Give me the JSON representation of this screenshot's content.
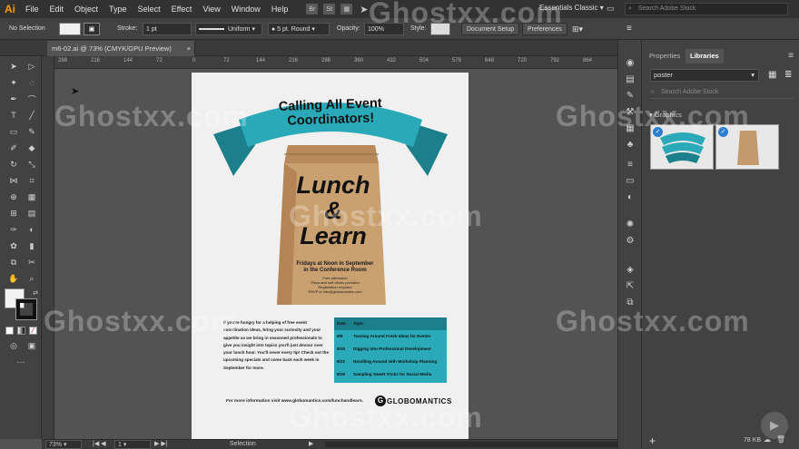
{
  "app": {
    "logo": "Ai",
    "menu": [
      "File",
      "Edit",
      "Object",
      "Type",
      "Select",
      "Effect",
      "View",
      "Window",
      "Help"
    ],
    "workspace": "Essentials Classic",
    "search_placeholder": "Search Adobe Stock",
    "bridge_icon": "Br",
    "stock_icon": "St"
  },
  "control": {
    "selection": "No Selection",
    "stroke_label": "Stroke:",
    "stroke_value": "1 pt",
    "profile": "Uniform",
    "brush": "5 pt. Round",
    "opacity_label": "Opacity:",
    "opacity_value": "100%",
    "style_label": "Style:",
    "doc_setup": "Document Setup",
    "preferences": "Preferences"
  },
  "document": {
    "tab_title": "m6-02.ai @ 73% (CMYK/GPU Preview)",
    "close": "×"
  },
  "ruler": {
    "ticks": [
      "288",
      "216",
      "144",
      "72",
      "0",
      "72",
      "144",
      "216",
      "288",
      "360",
      "432",
      "504",
      "576",
      "648",
      "720",
      "792",
      "864"
    ]
  },
  "poster": {
    "banner": "Calling All Event Coordinators!",
    "bag_line1": "Lunch",
    "bag_line2": "&",
    "bag_line3": "Learn",
    "bag_sub1": "Fridays at Noon in September",
    "bag_sub2": "in the Conference Room",
    "bag_small1": "Free admission",
    "bag_small2": "Pizza and soft drinks provided",
    "bag_small3": "Registration required",
    "bag_small4": "RSVP to info@globomantics.com",
    "body_text": "If you're hungry for a helping of free event coordination ideas, bring your curiosity and your appetite as we bring in seasoned professionals to give you insight into topics you'll just devour over your lunch hour. You'll never every tip! Check out the upcoming specials and come back each week in September for more.",
    "table_head_date": "Date",
    "table_head_topic": "Topic",
    "table_rows": [
      {
        "date": "9/8",
        "topic": "Tossing Around Fresh Ideas for Events"
      },
      {
        "date": "9/15",
        "topic": "Digging into Professional Development"
      },
      {
        "date": "9/22",
        "topic": "Noodling Around with Workshop Planning"
      },
      {
        "date": "9/29",
        "topic": "Sampling Sweet Tricks for Social Media"
      }
    ],
    "footer_prefix": "For more information visit",
    "footer_url": "www.globomantics.com/lunchandlearn.",
    "brand": "GLOBOMANTICS"
  },
  "status": {
    "zoom": "73%",
    "artboard": "1",
    "mode": "Selection"
  },
  "panel": {
    "tab_properties": "Properties",
    "tab_libraries": "Libraries",
    "library_name": "poster",
    "search_placeholder": "Search Adobe Stock",
    "section": "Graphics",
    "file_size": "78 KB"
  },
  "watermark": "Ghostxx.com",
  "colors": {
    "teal": "#2aa9b8",
    "teal_dark": "#1b7f8c",
    "bag": "#c49a6c",
    "accent": "#ff9a00"
  }
}
